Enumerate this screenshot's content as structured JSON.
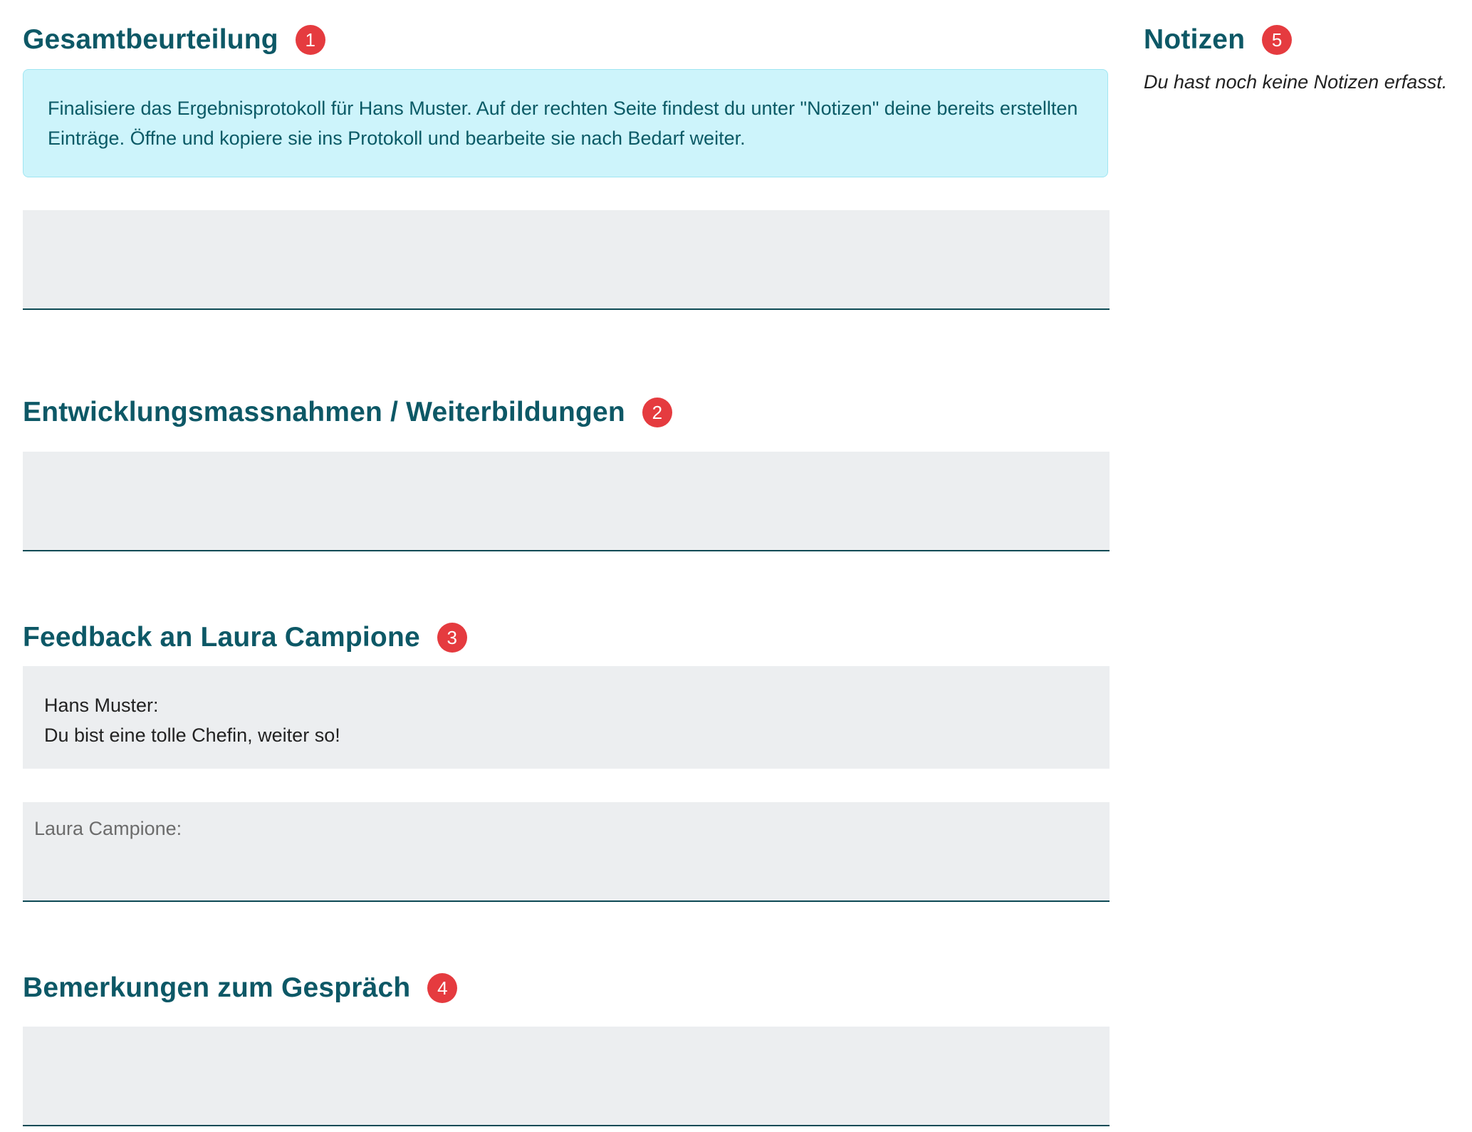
{
  "sections": {
    "gesamt": {
      "title": "Gesamtbeurteilung",
      "badge": "1",
      "info": "Finalisiere das Ergebnisprotokoll für Hans Muster. Auf der rechten Seite findest du unter \"Notizen\" deine bereits erstellten Einträge. Öffne und kopiere sie ins Protokoll und bearbeite sie nach Bedarf weiter.",
      "value": ""
    },
    "entwicklung": {
      "title": "Entwicklungsmassnahmen / Weiterbildungen",
      "badge": "2",
      "value": ""
    },
    "feedback": {
      "title": "Feedback an Laura Campione",
      "badge": "3",
      "author": "Hans Muster:",
      "message": "Du bist eine tolle Chefin, weiter so!",
      "reply_placeholder": "Laura Campione:",
      "reply_value": ""
    },
    "bemerkungen": {
      "title": "Bemerkungen zum Gespräch",
      "badge": "4",
      "value": ""
    }
  },
  "notes": {
    "title": "Notizen",
    "badge": "5",
    "empty_text": "Du hast noch keine Notizen erfasst."
  },
  "colors": {
    "heading": "#0d5866",
    "badge": "#e53b3f",
    "info_bg": "#cdf4fb",
    "field_bg": "#eceef0"
  }
}
